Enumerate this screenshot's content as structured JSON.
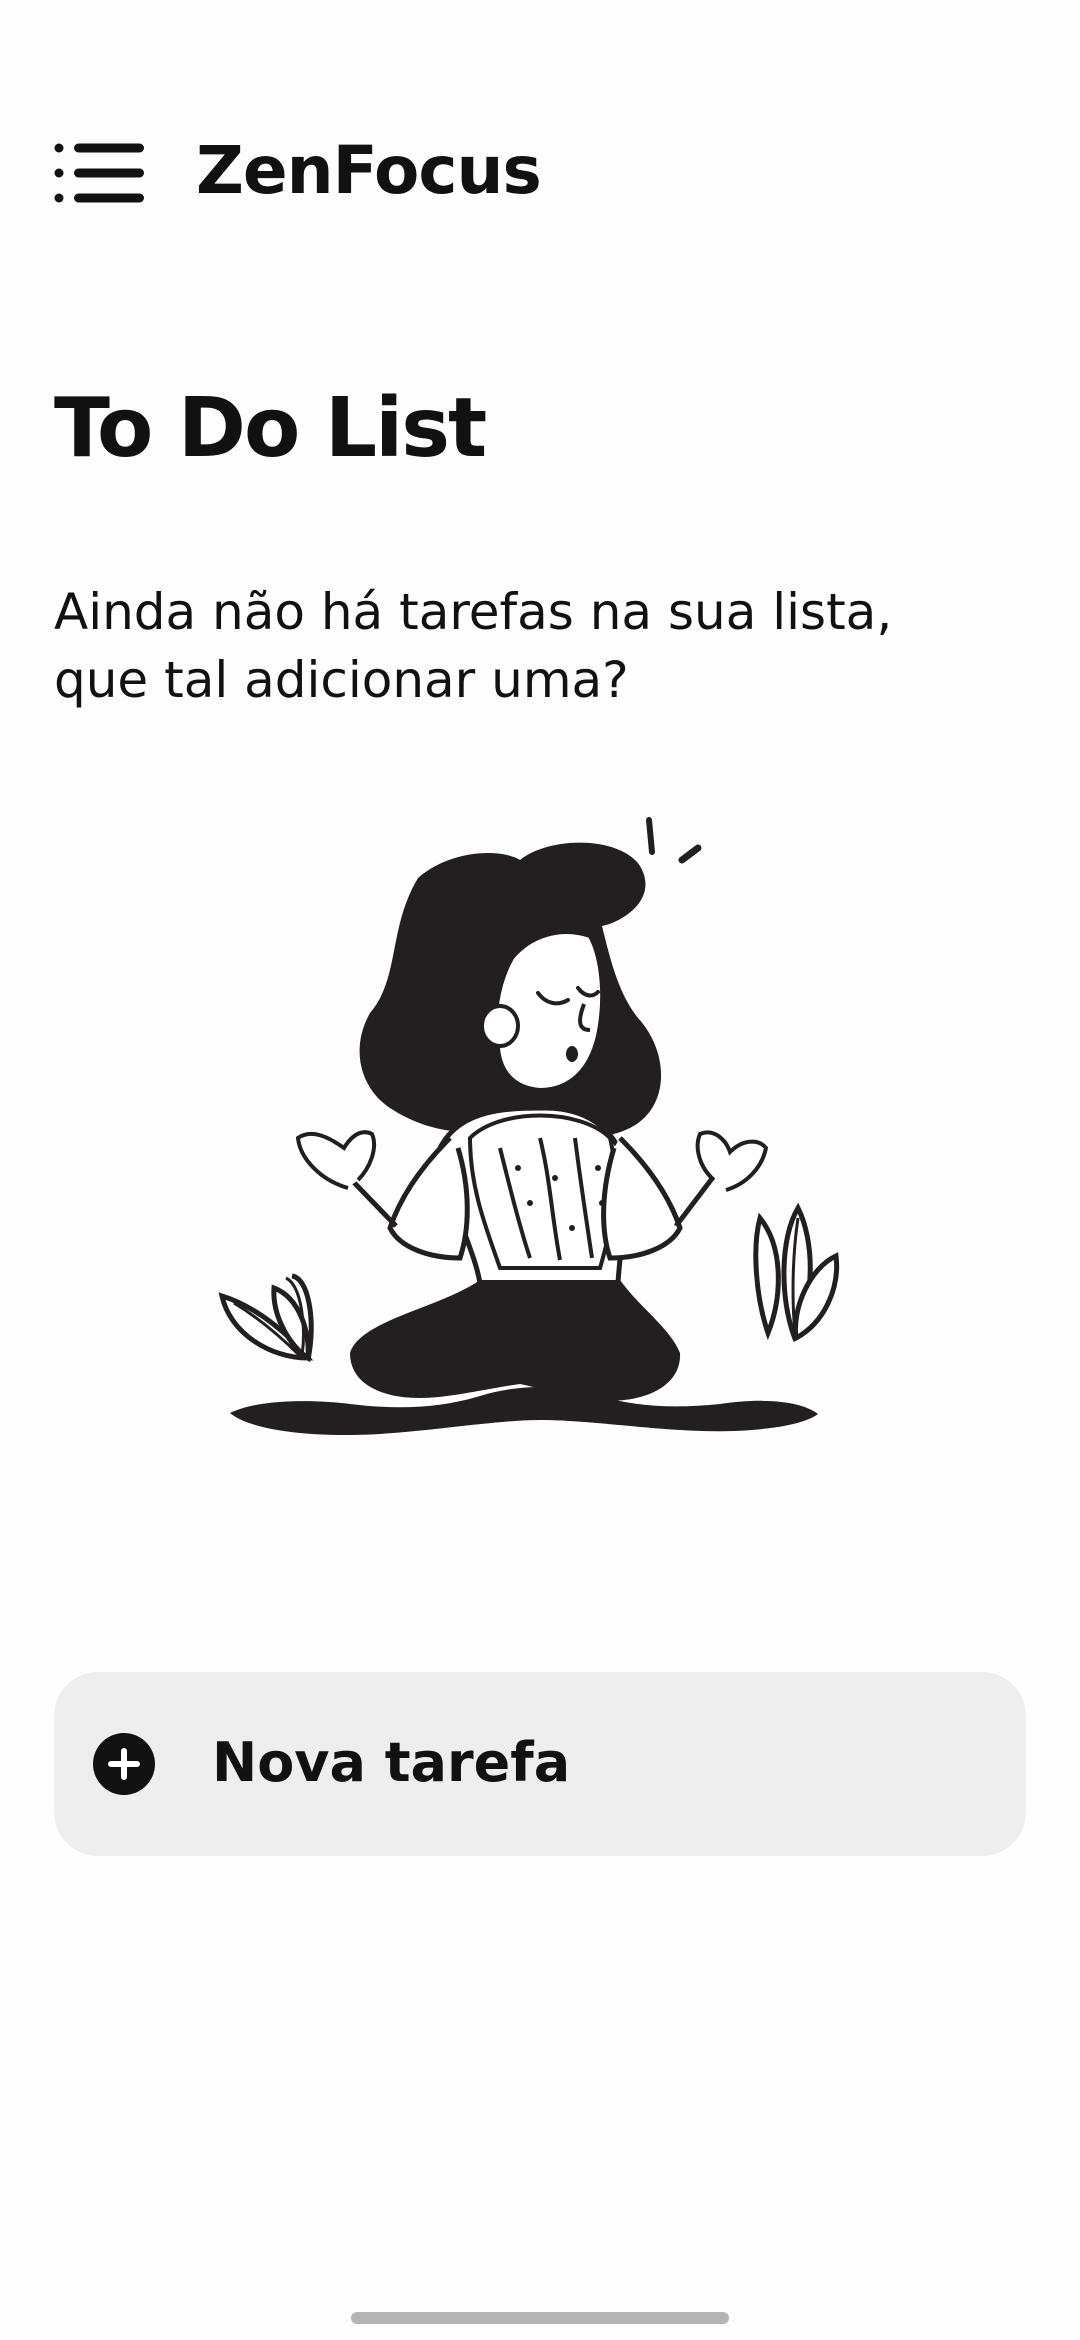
{
  "app": {
    "title": "ZenFocus"
  },
  "header": {
    "menu_icon": "menu-icon"
  },
  "main": {
    "page_title": "To Do List",
    "empty_message_lines": [
      "Ainda não há tarefas na sua lista,",
      "que tal adicionar uma?"
    ],
    "illustration": "meditating-woman-illustration"
  },
  "actions": {
    "new_task_label": "Nova tarefa",
    "new_task_icon": "plus-circle-icon"
  },
  "colors": {
    "background": "#fdfdfd",
    "text": "#111111",
    "button_background": "#eeeeee",
    "illustration_fill": "#231f20",
    "home_indicator": "#b4b4b4"
  }
}
